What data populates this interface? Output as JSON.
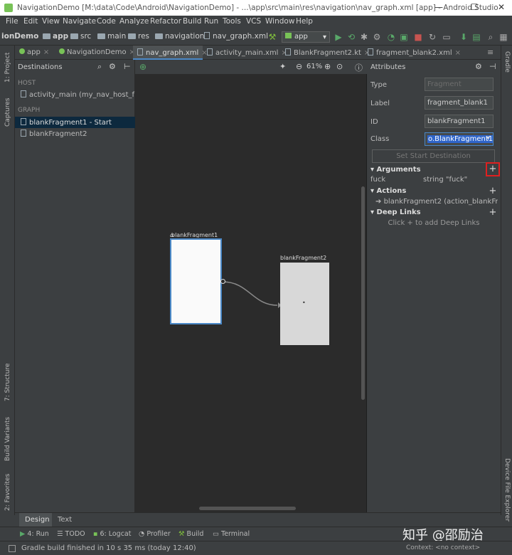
{
  "window": {
    "title": "NavigationDemo [M:\\data\\Code\\Android\\NavigationDemo] - ...\\app\\src\\main\\res\\navigation\\nav_graph.xml [app] - Android Studio",
    "minimize": "—",
    "maximize": "☐",
    "close": "✕"
  },
  "menu": [
    "File",
    "Edit",
    "View",
    "Navigate",
    "Code",
    "Analyze",
    "Refactor",
    "Build",
    "Run",
    "Tools",
    "VCS",
    "Window",
    "Help"
  ],
  "breadcrumbs": [
    "ionDemo",
    "app",
    "src",
    "main",
    "res",
    "navigation",
    "nav_graph.xml"
  ],
  "run_config": "app",
  "tabs": [
    {
      "label": "app"
    },
    {
      "label": "NavigationDemo"
    },
    {
      "label": "nav_graph.xml"
    },
    {
      "label": "activity_main.xml"
    },
    {
      "label": "BlankFragment2.kt"
    },
    {
      "label": "fragment_blank2.xml"
    }
  ],
  "left_strip": {
    "project": "1: Project",
    "captures": "Captures",
    "structure": "7: Structure",
    "build_variants": "Build Variants",
    "favorites": "2: Favorites"
  },
  "right_strip": {
    "gradle": "Gradle",
    "device_explorer": "Device File Explorer"
  },
  "destinations": {
    "header": "Destinations",
    "host_label": "HOST",
    "host_item": "activity_main (my_nav_host_fragme",
    "graph_label": "GRAPH",
    "items": [
      "blankFragment1 - Start",
      "blankFragment2"
    ]
  },
  "canvas": {
    "zoom": "61%",
    "node1_label": "blankFragment1",
    "node2_label": "blankFragment2"
  },
  "attributes": {
    "header": "Attributes",
    "type_label": "Type",
    "type_placeholder": "Fragment",
    "label_label": "Label",
    "label_value": "fragment_blank1",
    "id_label": "ID",
    "id_value": "blankFragment1",
    "class_label": "Class",
    "class_value": "o.BlankFragment1",
    "set_start": "Set Start Destination",
    "arguments_header": "Arguments",
    "argument_name": "fuck",
    "argument_value": "string  \"fuck\"",
    "actions_header": "Actions",
    "action_item": "blankFragment2 (action_blankFragm",
    "deeplinks_header": "Deep Links",
    "deeplinks_hint": "Click + to add Deep Links"
  },
  "design_tabs": [
    "Design",
    "Text"
  ],
  "tool_windows": [
    "4: Run",
    "TODO",
    "6: Logcat",
    "Profiler",
    "Build",
    "Terminal"
  ],
  "status": {
    "message": "Gradle build finished in 10 s 35 ms (today 12:40)",
    "context": "Context: <no context>"
  },
  "watermark": "知乎 @邵励治"
}
